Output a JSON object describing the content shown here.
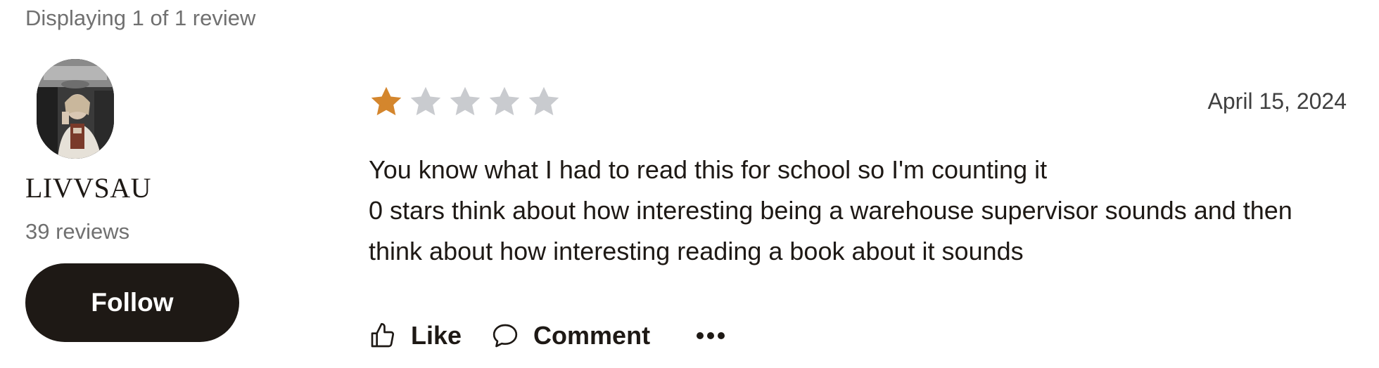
{
  "header": {
    "display_count": "Displaying 1 of 1 review"
  },
  "reviewer": {
    "name": "LIVVSAU",
    "review_count": "39 reviews",
    "follow_label": "Follow"
  },
  "review": {
    "rating": 1,
    "max_rating": 5,
    "date": "April 15, 2024",
    "text_lines": [
      "You know what I had to read this for school so I'm counting it",
      "0 stars think about how interesting being a warehouse supervisor sounds and then think about how interesting reading a book about it sounds"
    ],
    "actions": {
      "like_label": "Like",
      "comment_label": "Comment"
    }
  },
  "colors": {
    "star_filled": "#d4862d",
    "star_empty": "#c9cbcf",
    "button_bg": "#1e1915",
    "muted_text": "#707070"
  },
  "icons": {
    "like": "thumbs-up-icon",
    "comment": "speech-bubble-icon",
    "more": "ellipsis-icon"
  }
}
